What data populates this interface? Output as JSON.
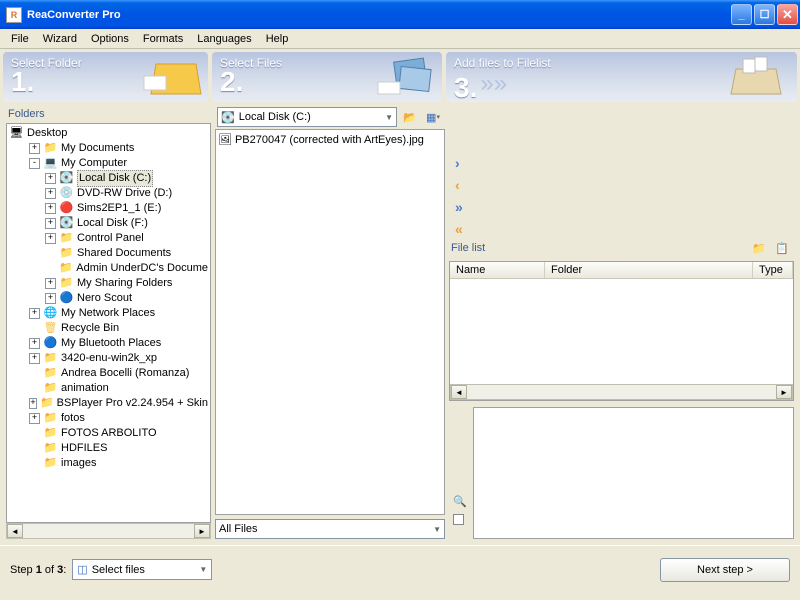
{
  "window": {
    "title": "ReaConverter Pro"
  },
  "menu": [
    "File",
    "Wizard",
    "Options",
    "Formats",
    "Languages",
    "Help"
  ],
  "steps": [
    {
      "title": "Select Folder",
      "num": "1."
    },
    {
      "title": "Select Files",
      "num": "2."
    },
    {
      "title": "Add files to Filelist",
      "num": "3."
    }
  ],
  "folders_label": "Folders",
  "tree": {
    "root": "Desktop",
    "items": [
      {
        "d": 1,
        "e": "+",
        "i": "📁",
        "t": "My Documents"
      },
      {
        "d": 1,
        "e": "-",
        "i": "💻",
        "t": "My Computer"
      },
      {
        "d": 2,
        "e": "+",
        "i": "💽",
        "t": "Local Disk (C:)",
        "sel": true
      },
      {
        "d": 2,
        "e": "+",
        "i": "💿",
        "t": "DVD-RW Drive (D:)"
      },
      {
        "d": 2,
        "e": "+",
        "i": "🔴",
        "t": "Sims2EP1_1 (E:)"
      },
      {
        "d": 2,
        "e": "+",
        "i": "💽",
        "t": "Local Disk (F:)"
      },
      {
        "d": 2,
        "e": "+",
        "i": "📁",
        "t": "Control Panel"
      },
      {
        "d": 2,
        "e": "",
        "i": "📁",
        "t": "Shared Documents"
      },
      {
        "d": 2,
        "e": "",
        "i": "📁",
        "t": "Admin UnderDC's Docume"
      },
      {
        "d": 2,
        "e": "+",
        "i": "📁",
        "t": "My Sharing Folders"
      },
      {
        "d": 2,
        "e": "+",
        "i": "🔵",
        "t": "Nero Scout"
      },
      {
        "d": 1,
        "e": "+",
        "i": "🌐",
        "t": "My Network Places"
      },
      {
        "d": 1,
        "e": "",
        "i": "🗑",
        "t": "Recycle Bin"
      },
      {
        "d": 1,
        "e": "+",
        "i": "🔵",
        "t": "My Bluetooth Places"
      },
      {
        "d": 1,
        "e": "+",
        "i": "📁",
        "t": "3420-enu-win2k_xp"
      },
      {
        "d": 1,
        "e": "",
        "i": "📁",
        "t": "Andrea Bocelli (Romanza)"
      },
      {
        "d": 1,
        "e": "",
        "i": "📁",
        "t": "animation"
      },
      {
        "d": 1,
        "e": "+",
        "i": "📁",
        "t": "BSPlayer Pro v2.24.954 + Skin"
      },
      {
        "d": 1,
        "e": "+",
        "i": "📁",
        "t": "fotos"
      },
      {
        "d": 1,
        "e": "",
        "i": "📁",
        "t": "FOTOS ARBOLITO"
      },
      {
        "d": 1,
        "e": "",
        "i": "📁",
        "t": "HDFILES"
      },
      {
        "d": 1,
        "e": "",
        "i": "📁",
        "t": "images"
      }
    ]
  },
  "p2": {
    "drive": "Local Disk (C:)",
    "files": [
      "PB270047 (corrected with ArtEyes).jpg"
    ],
    "filter": "All Files"
  },
  "filelist": {
    "label": "File list",
    "cols": [
      "Name",
      "Folder",
      "Type"
    ]
  },
  "footer": {
    "step_text": "Step 1 of 3:",
    "current": "Select files",
    "next": "Next step >"
  }
}
